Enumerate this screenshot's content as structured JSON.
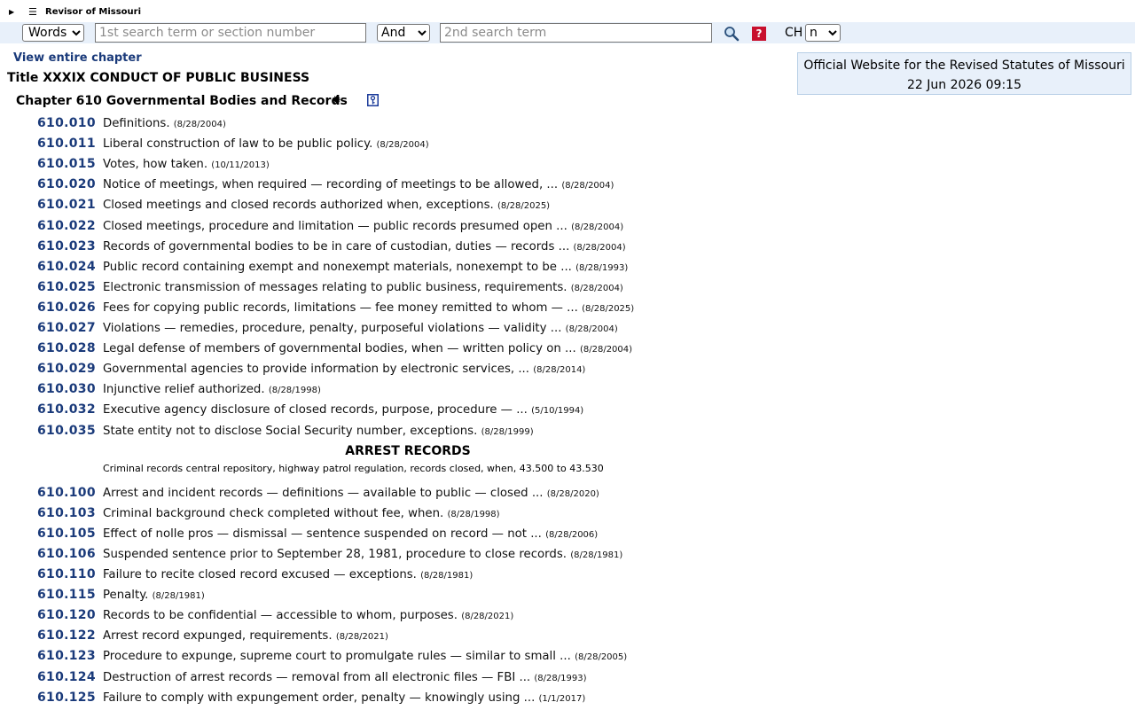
{
  "header": {
    "brand": "Revisor of Missouri",
    "menu_icon": "hamburger-icon",
    "expand_icon": "triangle-right-icon"
  },
  "search": {
    "mode_value": "Words",
    "term1_placeholder": "1st search term or section number",
    "operator_value": "And",
    "term2_placeholder": "2nd search term",
    "ch_label": "CH",
    "ch_value": "n",
    "help_label": "?"
  },
  "info": {
    "line1": "Official Website for the Revised Statutes of Missouri",
    "line2": "22 Jun 2026 09:15"
  },
  "view_chapter": "View entire chapter",
  "title": "Title XXXIX CONDUCT OF PUBLIC BUSINESS",
  "chapter": "Chapter 610 Governmental Bodies and Records",
  "sections_a": [
    {
      "num": "610.010",
      "text": "Definitions.",
      "date": "(8/28/2004)"
    },
    {
      "num": "610.011",
      "text": "Liberal construction of law to be public policy.",
      "date": "(8/28/2004)"
    },
    {
      "num": "610.015",
      "text": "Votes, how taken.",
      "date": "(10/11/2013)"
    },
    {
      "num": "610.020",
      "text": "Notice of meetings, when required — recording of meetings to be allowed, ...",
      "date": "(8/28/2004)"
    },
    {
      "num": "610.021",
      "text": "Closed meetings and closed records authorized when, exceptions.",
      "date": "(8/28/2025)"
    },
    {
      "num": "610.022",
      "text": "Closed meetings, procedure and limitation — public records presumed open ...",
      "date": "(8/28/2004)"
    },
    {
      "num": "610.023",
      "text": "Records of governmental bodies to be in care of custodian, duties — records ...",
      "date": "(8/28/2004)"
    },
    {
      "num": "610.024",
      "text": "Public record containing exempt and nonexempt materials, nonexempt to be ...",
      "date": "(8/28/1993)"
    },
    {
      "num": "610.025",
      "text": "Electronic transmission of messages relating to public business, requirements.",
      "date": "(8/28/2004)"
    },
    {
      "num": "610.026",
      "text": "Fees for copying public records, limitations — fee money remitted to whom — ...",
      "date": "(8/28/2025)"
    },
    {
      "num": "610.027",
      "text": "Violations — remedies, procedure, penalty, purposeful violations — validity ...",
      "date": "(8/28/2004)"
    },
    {
      "num": "610.028",
      "text": "Legal defense of members of governmental bodies, when — written policy on ...",
      "date": "(8/28/2004)"
    },
    {
      "num": "610.029",
      "text": "Governmental agencies to provide information by electronic services, ...",
      "date": "(8/28/2014)"
    },
    {
      "num": "610.030",
      "text": "Injunctive relief authorized.",
      "date": "(8/28/1998)"
    },
    {
      "num": "610.032",
      "text": "Executive agency disclosure of closed records, purpose, procedure — ...",
      "date": "(5/10/1994)"
    },
    {
      "num": "610.035",
      "text": "State entity not to disclose Social Security number, exceptions.",
      "date": "(8/28/1999)"
    }
  ],
  "group": {
    "heading": "ARREST RECORDS",
    "note": "Criminal records central repository, highway patrol regulation, records closed, when, 43.500 to 43.530"
  },
  "sections_b": [
    {
      "num": "610.100",
      "text": "Arrest and incident records — definitions — available to public — closed ...",
      "date": "(8/28/2020)"
    },
    {
      "num": "610.103",
      "text": "Criminal background check completed without fee, when.",
      "date": "(8/28/1998)"
    },
    {
      "num": "610.105",
      "text": "Effect of nolle pros — dismissal — sentence suspended on record — not ...",
      "date": "(8/28/2006)"
    },
    {
      "num": "610.106",
      "text": "Suspended sentence prior to September 28, 1981, procedure to close records.",
      "date": "(8/28/1981)"
    },
    {
      "num": "610.110",
      "text": "Failure to recite closed record excused — exceptions.",
      "date": "(8/28/1981)"
    },
    {
      "num": "610.115",
      "text": "Penalty.",
      "date": "(8/28/1981)"
    },
    {
      "num": "610.120",
      "text": "Records to be confidential — accessible to whom, purposes.",
      "date": "(8/28/2021)"
    },
    {
      "num": "610.122",
      "text": "Arrest record expunged, requirements.",
      "date": "(8/28/2021)"
    },
    {
      "num": "610.123",
      "text": "Procedure to expunge, supreme court to promulgate rules — similar to small ...",
      "date": "(8/28/2005)"
    },
    {
      "num": "610.124",
      "text": "Destruction of arrest records — removal from all electronic files — FBI ...",
      "date": "(8/28/1993)"
    },
    {
      "num": "610.125",
      "text": "Failure to comply with expungement order, penalty — knowingly using ...",
      "date": "(1/1/2017)"
    }
  ]
}
